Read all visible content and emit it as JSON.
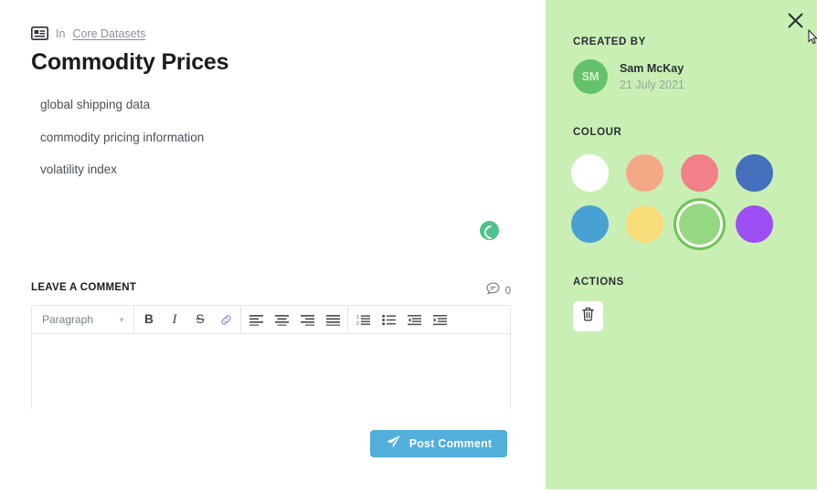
{
  "breadcrumb": {
    "icon": "card-view-icon",
    "prefix": "In",
    "link": "Core Datasets"
  },
  "page_title": "Commodity Prices",
  "description_lines": [
    "global shipping data",
    "commodity pricing information",
    "volatility index"
  ],
  "loading_indicator": {
    "name": "loading-spinner",
    "color": "#4cc38a"
  },
  "comments": {
    "section_label": "LEAVE A COMMENT",
    "count": "0",
    "count_icon": "comment-bubble-icon",
    "editor": {
      "block_format": "Paragraph",
      "body_value": "",
      "toolbar": [
        {
          "name": "bold-button",
          "glyph": "B",
          "kind": "b"
        },
        {
          "name": "italic-button",
          "glyph": "I",
          "kind": "i"
        },
        {
          "name": "strikethrough-button",
          "glyph": "S",
          "kind": "s"
        },
        {
          "name": "link-button",
          "glyph": "link",
          "kind": "svg"
        },
        {
          "name": "align-left-button",
          "glyph": "align-left",
          "kind": "svg"
        },
        {
          "name": "align-center-button",
          "glyph": "align-center",
          "kind": "svg"
        },
        {
          "name": "align-right-button",
          "glyph": "align-right",
          "kind": "svg"
        },
        {
          "name": "align-justify-button",
          "glyph": "align-justify",
          "kind": "svg"
        },
        {
          "name": "ordered-list-button",
          "glyph": "ordered-list",
          "kind": "svg"
        },
        {
          "name": "bullet-list-button",
          "glyph": "bullet-list",
          "kind": "svg"
        },
        {
          "name": "outdent-button",
          "glyph": "outdent",
          "kind": "svg"
        },
        {
          "name": "indent-button",
          "glyph": "indent",
          "kind": "svg"
        }
      ]
    },
    "post_button": {
      "label": "Post Comment",
      "icon": "send-paper-plane-icon",
      "color": "#52aedb"
    }
  },
  "panel": {
    "background": "#c9efb5",
    "close_icon": "close-x-icon",
    "created_by": {
      "title": "CREATED BY",
      "avatar_initials": "SM",
      "avatar_color": "#64c36a",
      "name": "Sam McKay",
      "date": "21 July 2021"
    },
    "colour": {
      "title": "COLOUR",
      "swatches": [
        {
          "name": "colour-swatch-white",
          "hex": "#ffffff",
          "selected": false
        },
        {
          "name": "colour-swatch-orange",
          "hex": "#f5a886",
          "selected": false
        },
        {
          "name": "colour-swatch-red",
          "hex": "#f2808a",
          "selected": false
        },
        {
          "name": "colour-swatch-navy-blue",
          "hex": "#4570be",
          "selected": false
        },
        {
          "name": "colour-swatch-blue",
          "hex": "#49a0d3",
          "selected": false
        },
        {
          "name": "colour-swatch-yellow",
          "hex": "#f8dc7a",
          "selected": false
        },
        {
          "name": "colour-swatch-green",
          "hex": "#96d881",
          "selected": true
        },
        {
          "name": "colour-swatch-purple",
          "hex": "#9d4ef5",
          "selected": false
        }
      ]
    },
    "actions": {
      "title": "ACTIONS",
      "buttons": [
        {
          "name": "delete-button",
          "icon": "trash-icon"
        }
      ]
    }
  }
}
